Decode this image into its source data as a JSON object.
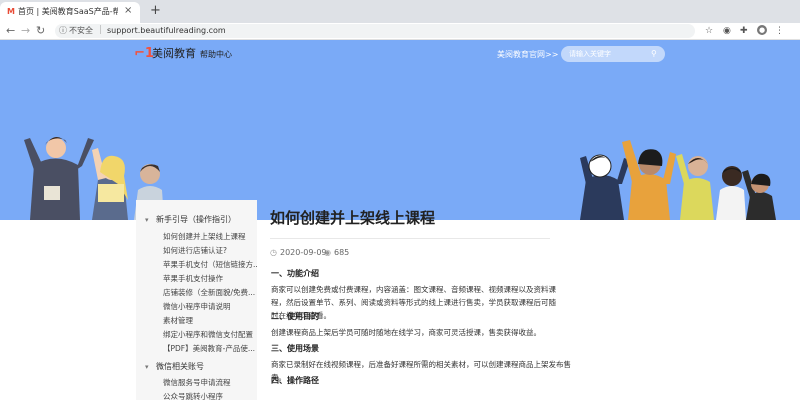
{
  "browser": {
    "tab_title": "首页 | 美阅教育SaaS产品-帮助中心",
    "new_tab": "+",
    "insecure_label": "不安全",
    "url": "support.beautifulreading.com"
  },
  "header": {
    "logo_text": "美阅教育",
    "logo_sub": "帮助中心",
    "official_link": "美阅教育官网>>",
    "search_placeholder": "请输入关键字"
  },
  "sidebar": {
    "section1": "新手引导（操作指引）",
    "items": [
      "如何创建并上架线上课程",
      "如何进行店铺认证?",
      "苹果手机支付（短信链接方...",
      "苹果手机支付操作",
      "店铺装修（全新面貌/免费...",
      "微信小程序申请说明",
      "素材管理",
      "绑定小程序和微信支付配置",
      "【PDF】美阅教育-产品使..."
    ],
    "section2": "微信相关账号",
    "items2": [
      "微信服务号申请流程",
      "公众号跳转小程序"
    ]
  },
  "article": {
    "title": "如何创建并上架线上课程",
    "date": "2020-09-09",
    "views": "685",
    "sections": [
      {
        "heading": "一、功能介绍",
        "body": "商家可以创建免费或付费课程，内容涵盖：图文课程、音频课程、视频课程以及资料课程，然后设置单节、系列、阅读或资料等形式的线上课进行售卖，学员获取课程后可随时在线学习查看。"
      },
      {
        "heading": "二、使用目的",
        "body": "创建课程商品上架后学员可随时随地在线学习，商家可灵活授课，售卖获得收益。"
      },
      {
        "heading": "三、使用场景",
        "body": "商家已录制好在线视频课程，后准备好课程所需的相关素材，可以创建课程商品上架发布售卖。"
      },
      {
        "heading": "四、操作路径",
        "body": ""
      }
    ]
  },
  "colors": {
    "header_bg": "#7aaaf7",
    "logo_accent": "#f3523c"
  }
}
